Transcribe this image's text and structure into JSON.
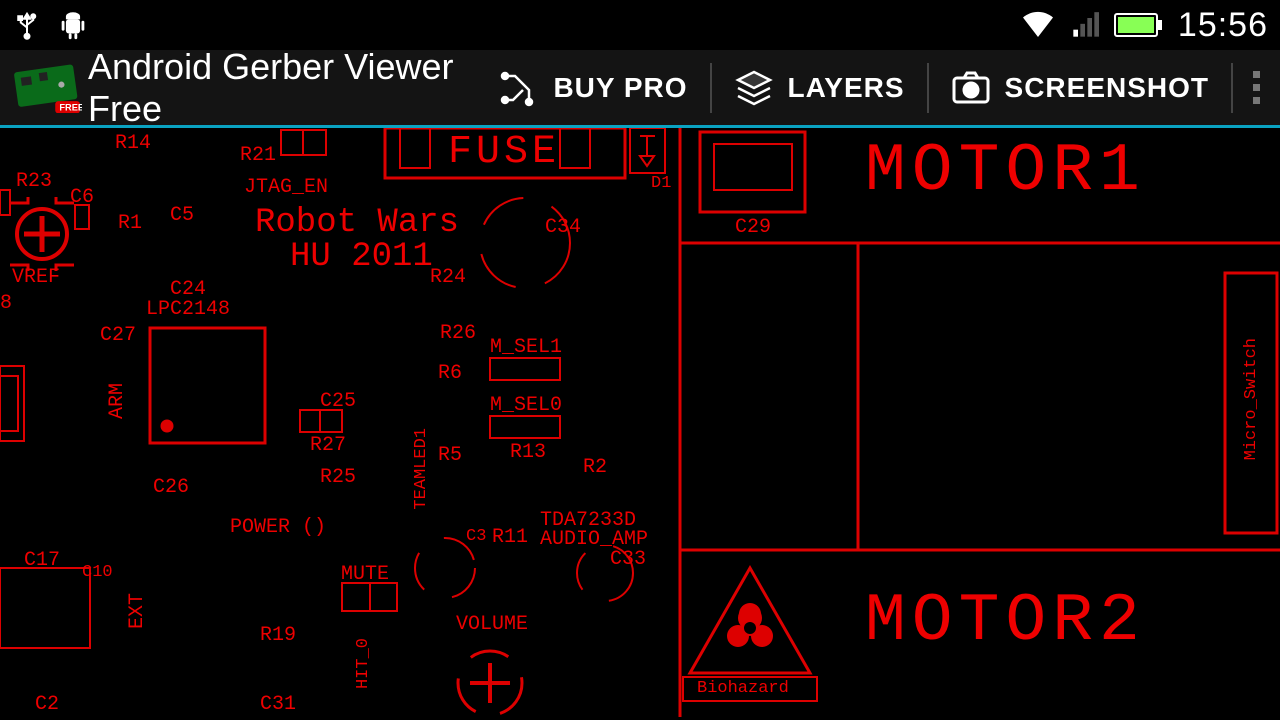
{
  "status_bar": {
    "clock": "15:56"
  },
  "app_bar": {
    "title": "Android Gerber Viewer Free",
    "actions": {
      "buy_pro": "BUY PRO",
      "layers": "LAYERS",
      "screenshot": "SCREENSHOT"
    }
  },
  "pcb": {
    "color": "#e00000",
    "motor1": "MOTOR1",
    "motor2": "MOTOR2",
    "fuse": "FUSE",
    "title1": "Robot Wars",
    "title2": "HU 2011",
    "labels": {
      "r14": "R14",
      "r21": "R21",
      "r23": "R23",
      "r1": "R1",
      "c5": "C5",
      "c24": "C24",
      "c27": "C27",
      "c26": "C26",
      "c25": "C25",
      "r27": "R27",
      "r25": "R25",
      "r26": "R26",
      "r6": "R6",
      "r5": "R5",
      "r24": "R24",
      "r13": "R13",
      "r2": "R2",
      "c3": "C3",
      "r11": "R11",
      "c33": "C33",
      "c34": "C34",
      "c29": "C29",
      "d1": "D1",
      "lpc2148": "LPC2148",
      "power": "POWER ()",
      "msel1": "M_SEL1",
      "msel0": "M_SEL0",
      "mute": "MUTE",
      "volume": "VOLUME",
      "tda": "TDA7233D",
      "audio_amp": "AUDIO_AMP",
      "biohazard": "Biohazard",
      "jtag_en": "JTAG_EN",
      "vref": "VREF",
      "c6": "C6",
      "c17": "C17",
      "c2": "C2",
      "c31": "C31",
      "r19": "R19",
      "c10": "C10",
      "c8": "8",
      "arm": "ARM",
      "ext": "EXT",
      "microswitch": "Micro_Switch",
      "teamled1": "TEAMLED1",
      "hit0": "HIT_0"
    }
  }
}
